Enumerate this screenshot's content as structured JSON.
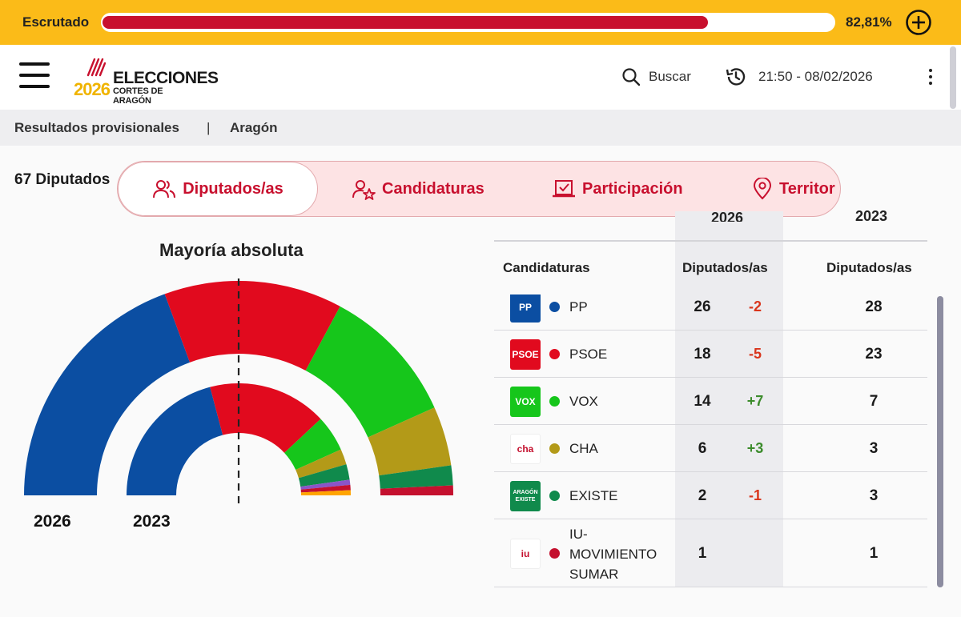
{
  "topbar": {
    "label": "Escrutado",
    "progress_pct": 82.81,
    "progress_text": "82,81%",
    "accent": "#fbbb18",
    "bar_color": "#c8102e"
  },
  "header": {
    "logo_title": "ELECCIONES",
    "logo_subtitle": "CORTES DE ARAGÓN",
    "logo_year": "2026",
    "search_label": "Buscar",
    "datetime": "21:50 - 08/02/2026"
  },
  "breadcrumb": {
    "level1": "Resultados provisionales",
    "separator": "|",
    "level2": "Aragón"
  },
  "seats_total": "67 Diputados",
  "tabs": [
    {
      "label": "Diputados/as",
      "icon": "users-icon",
      "active": true
    },
    {
      "label": "Candidaturas",
      "icon": "user-star-icon",
      "active": false
    },
    {
      "label": "Participación",
      "icon": "ballot-icon",
      "active": false
    },
    {
      "label": "Territor",
      "icon": "map-pin-icon",
      "active": false
    }
  ],
  "chart": {
    "title": "Mayoría absoluta",
    "outer_year": "2026",
    "inner_year": "2023"
  },
  "chart_data": {
    "type": "pie",
    "subtype": "parliament-hemicycle",
    "title": "Mayoría absoluta",
    "total_seats": 67,
    "series": [
      {
        "name": "2026",
        "ring": "outer",
        "values": [
          {
            "party": "PP",
            "seats": 26,
            "color": "#0b4ea2"
          },
          {
            "party": "PSOE",
            "seats": 18,
            "color": "#e10a1e"
          },
          {
            "party": "VOX",
            "seats": 14,
            "color": "#16c61b"
          },
          {
            "party": "CHA",
            "seats": 6,
            "color": "#b39a18"
          },
          {
            "party": "EXISTE",
            "seats": 2,
            "color": "#108a4c"
          },
          {
            "party": "IU-MOVIMIENTO SUMAR",
            "seats": 1,
            "color": "#c4102e"
          }
        ]
      },
      {
        "name": "2023",
        "ring": "inner",
        "values": [
          {
            "party": "PP",
            "seats": 28,
            "color": "#0b4ea2"
          },
          {
            "party": "PSOE",
            "seats": 23,
            "color": "#e10a1e"
          },
          {
            "party": "VOX",
            "seats": 7,
            "color": "#16c61b"
          },
          {
            "party": "CHA",
            "seats": 3,
            "color": "#b39a18"
          },
          {
            "party": "EXISTE",
            "seats": 3,
            "color": "#108a4c"
          },
          {
            "party": "",
            "seats": 1,
            "color": "#8a55c8"
          },
          {
            "party": "IU-MOVIMIENTO SUMAR",
            "seats": 1,
            "color": "#c4102e"
          },
          {
            "party": "",
            "seats": 1,
            "color": "#ffa400"
          }
        ]
      }
    ]
  },
  "table": {
    "year_current": "2026",
    "year_prev": "2023",
    "col_party": "Candidaturas",
    "col_seats_current": "Diputados/as",
    "col_seats_prev": "Diputados/as",
    "rows": [
      {
        "logo": "PP",
        "name": "PP",
        "color": "#0b4ea2",
        "logo_bg": "#0b4ea2",
        "seats": "26",
        "diff": "-2",
        "prev": "28"
      },
      {
        "logo": "PSOE",
        "name": "PSOE",
        "color": "#e10a1e",
        "logo_bg": "#e10a1e",
        "seats": "18",
        "diff": "-5",
        "prev": "23"
      },
      {
        "logo": "VOX",
        "name": "VOX",
        "color": "#16c61b",
        "logo_bg": "#16c61b",
        "seats": "14",
        "diff": "+7",
        "prev": "7"
      },
      {
        "logo": "cha",
        "name": "CHA",
        "color": "#b39a18",
        "logo_bg": "#ffffff",
        "seats": "6",
        "diff": "+3",
        "prev": "3"
      },
      {
        "logo": "ARAGÓN EXISTE",
        "name": "EXISTE",
        "color": "#108a4c",
        "logo_bg": "#108a4c",
        "seats": "2",
        "diff": "-1",
        "prev": "3"
      },
      {
        "logo": "iu",
        "name_lines": [
          "IU-",
          "MOVIMIENTO",
          "SUMAR"
        ],
        "color": "#c4102e",
        "logo_bg": "#ffffff",
        "seats": "1",
        "diff": "",
        "prev": "1"
      }
    ]
  }
}
